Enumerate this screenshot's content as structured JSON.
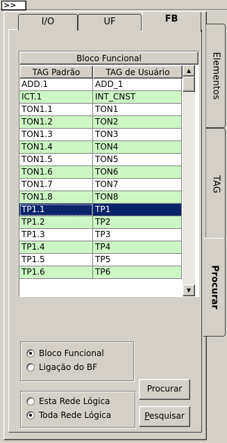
{
  "toolbar": {
    "expand_label": ">>"
  },
  "tabs": {
    "io": "I/O",
    "uf": "UF",
    "fb": "FB",
    "active": "fb"
  },
  "side_tabs": {
    "elementos": "Elementos",
    "tag": "TAG",
    "procurar": "Procurar",
    "active": "procurar"
  },
  "grid": {
    "caption": "Bloco Funcional",
    "col_tag_padrao": "TAG Padrão",
    "col_tag_usuario": "TAG de Usuário",
    "rows": [
      {
        "tag": "ADD.1",
        "user": "ADD_1"
      },
      {
        "tag": "ICT.1",
        "user": "INT_CNST"
      },
      {
        "tag": "TON1.1",
        "user": "TON1"
      },
      {
        "tag": "TON1.2",
        "user": "TON2"
      },
      {
        "tag": "TON1.3",
        "user": "TON3"
      },
      {
        "tag": "TON1.4",
        "user": "TON4"
      },
      {
        "tag": "TON1.5",
        "user": "TON5"
      },
      {
        "tag": "TON1.6",
        "user": "TON6"
      },
      {
        "tag": "TON1.7",
        "user": "TON7"
      },
      {
        "tag": "TON1.8",
        "user": "TON8"
      },
      {
        "tag": "TP1.1",
        "user": "TP1"
      },
      {
        "tag": "TP1.2",
        "user": "TP2"
      },
      {
        "tag": "TP1.3",
        "user": "TP3"
      },
      {
        "tag": "TP1.4",
        "user": "TP4"
      },
      {
        "tag": "TP1.5",
        "user": "TP5"
      },
      {
        "tag": "TP1.6",
        "user": "TP6"
      }
    ],
    "selected_row_index": 10
  },
  "search_type": {
    "options": [
      "Bloco Funcional",
      "Ligação do BF"
    ],
    "selected": "Bloco Funcional"
  },
  "scope": {
    "options": [
      "Esta Rede Lógica",
      "Toda Rede Lógica"
    ],
    "selected": "Toda Rede Lógica"
  },
  "buttons": {
    "procurar": "Procurar",
    "pesquisar_rest": "esquisar",
    "pesquisar_accel": "P"
  },
  "colors": {
    "alt_row": "#ccf7c4",
    "selected_row": "#0a246a",
    "face": "#d4d0c8"
  }
}
